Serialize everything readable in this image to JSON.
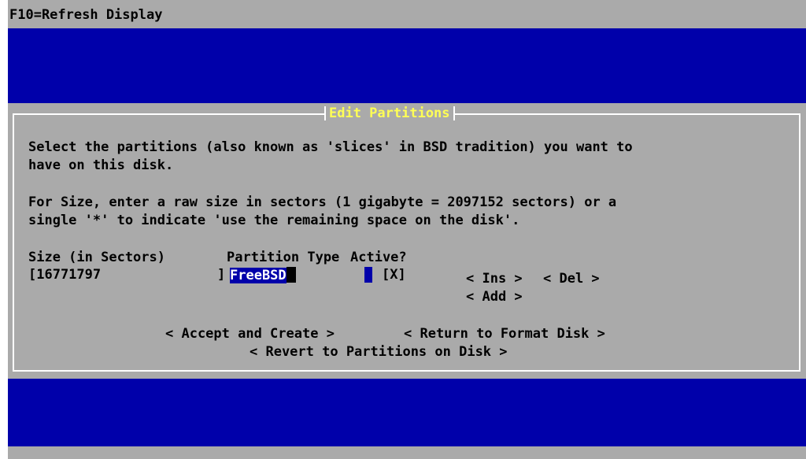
{
  "topbar": {
    "hint": "F10=Refresh Display"
  },
  "dialog": {
    "title": "Edit Partitions",
    "para1_line1": "Select the partitions (also known as 'slices' in BSD tradition) you want to",
    "para1_line2": "have on this disk.",
    "para2_line1": "For Size, enter a raw size in sectors (1 gigabyte = 2097152 sectors) or a",
    "para2_line2": "single '*' to indicate 'use the remaining space on the disk'.",
    "headers": {
      "size": "Size (in Sectors)",
      "type": "Partition Type",
      "active": "Active?"
    },
    "row": {
      "size_open": "[16771797",
      "size_close": "]",
      "type_value": "FreeBSD",
      "active": "[X]"
    },
    "buttons": {
      "ins": "< Ins >",
      "del": "< Del >",
      "add": "< Add >",
      "accept": "< Accept and Create >",
      "return": "< Return to Format Disk >",
      "revert": "< Revert to Partitions on Disk >"
    }
  }
}
